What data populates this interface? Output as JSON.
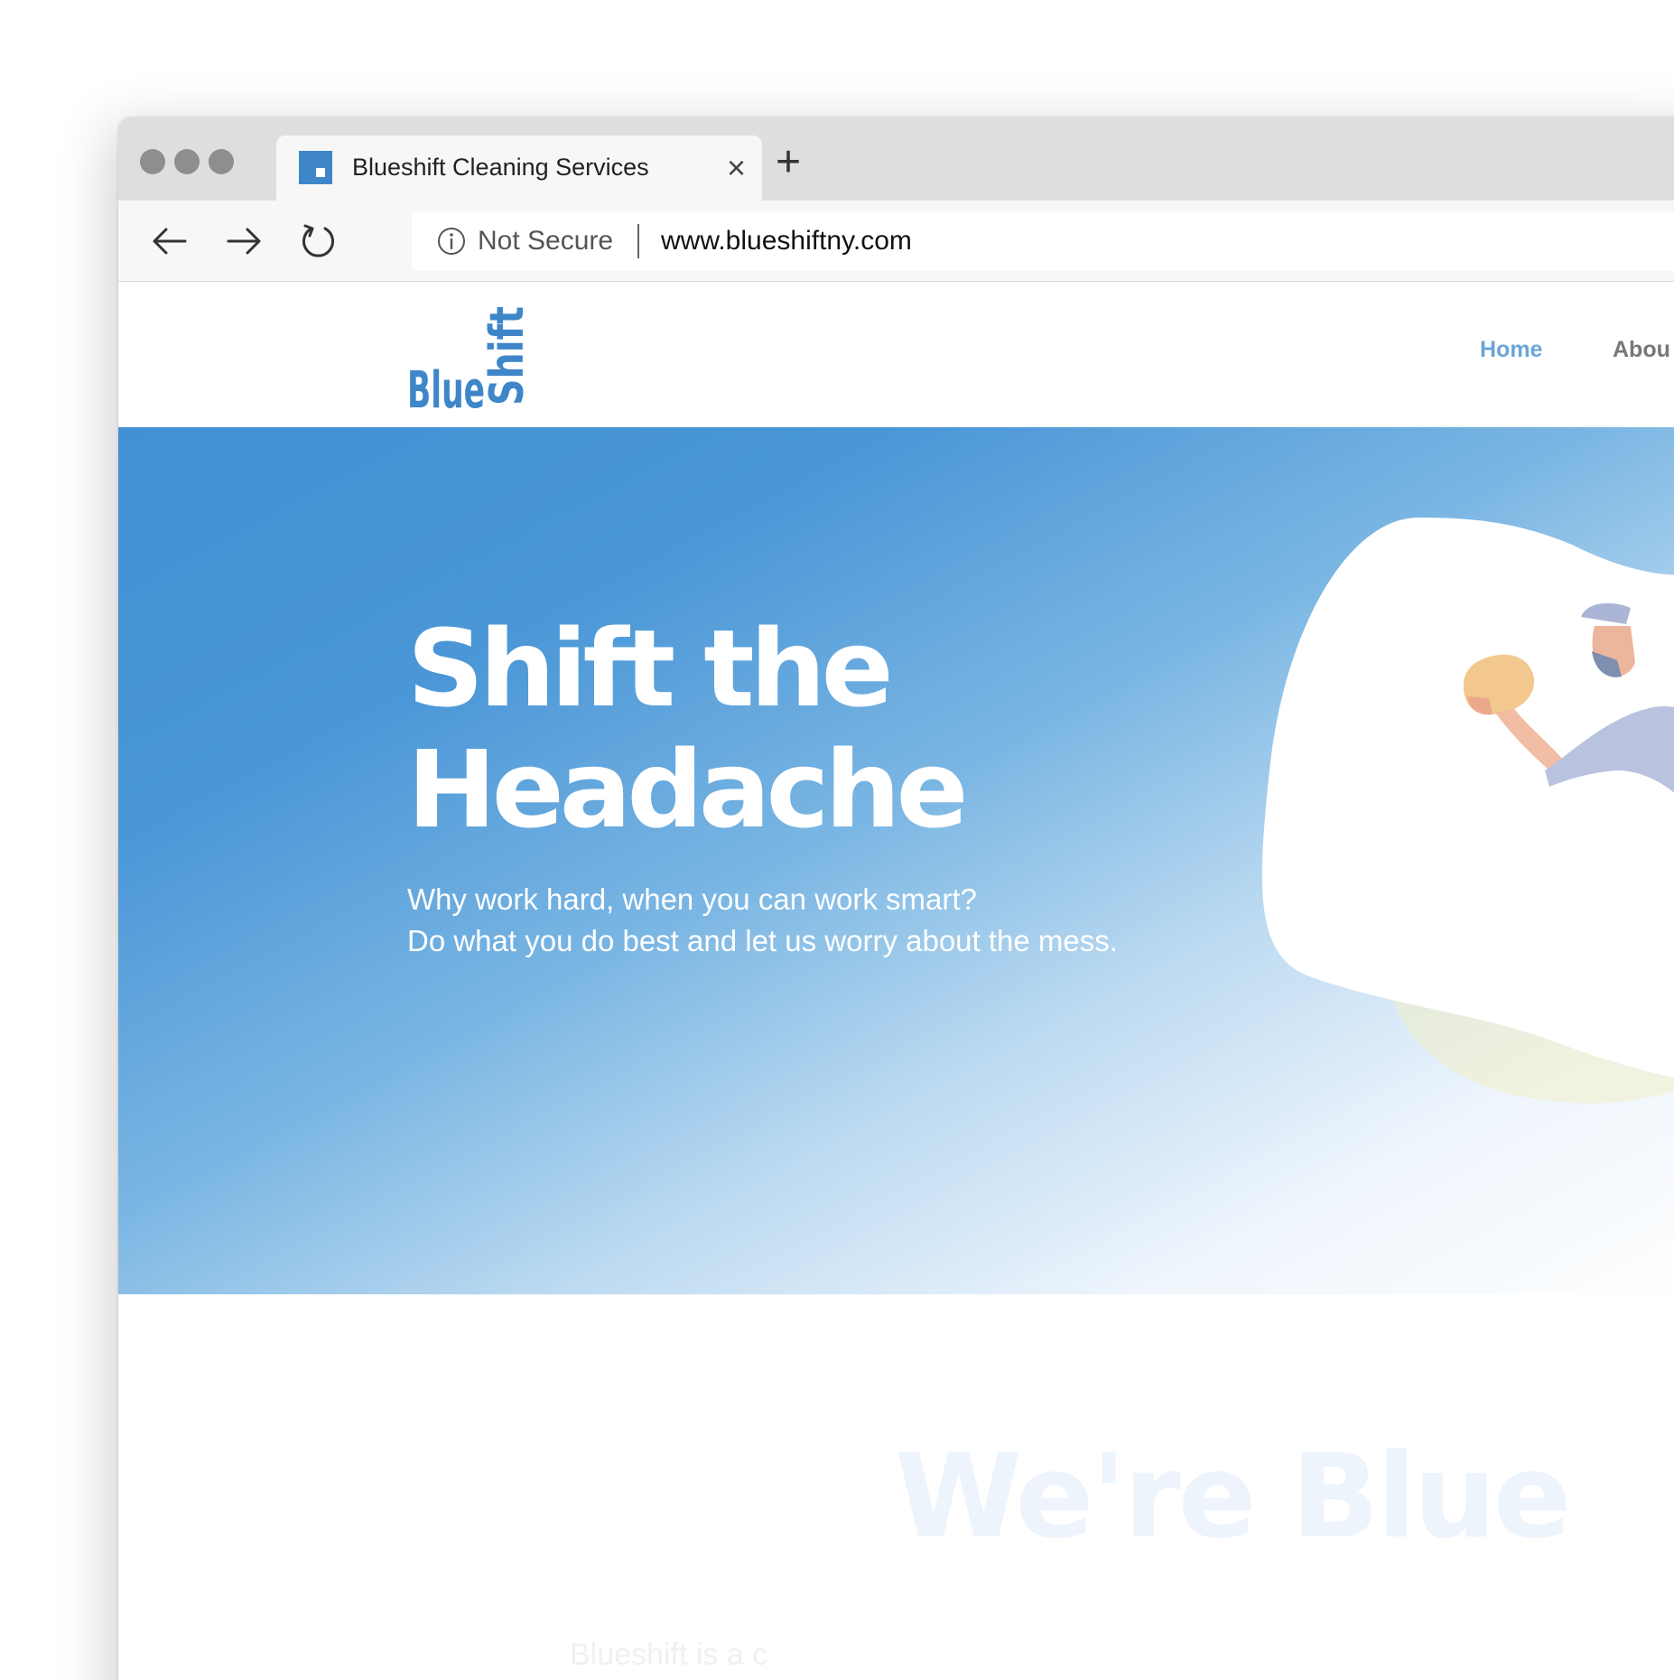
{
  "browser": {
    "tab_title": "Blueshift Cleaning Services",
    "tab_close": "×",
    "new_tab": "+",
    "security_label": "Not Secure",
    "url": "www.blueshiftny.com"
  },
  "site": {
    "logo_text_main": "Blue",
    "logo_text_vertical": "Shift",
    "brand_color": "#3f86c9",
    "nav": {
      "home": "Home",
      "about": "Abou"
    }
  },
  "hero": {
    "title_line1": "Shift the",
    "title_line2": "Headache",
    "subtitle_line1": "Why work hard, when you can work smart?",
    "subtitle_line2": "Do what you do best and let us worry about the mess."
  },
  "section": {
    "heading": "We're Blue",
    "text": "Blueshift is a c"
  }
}
